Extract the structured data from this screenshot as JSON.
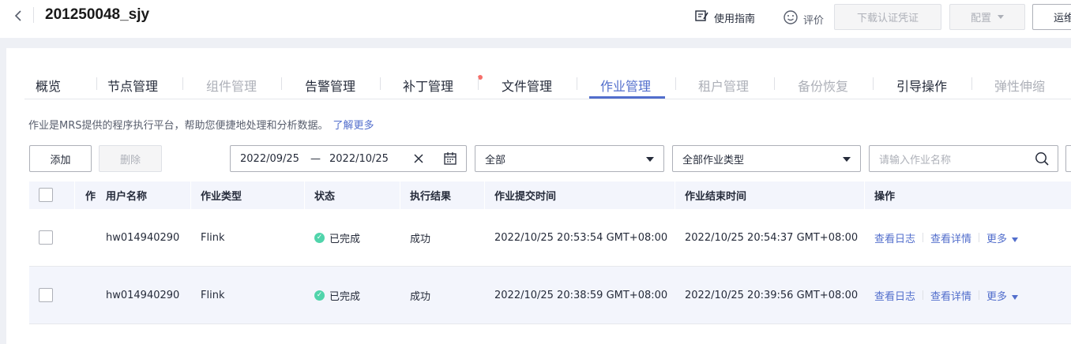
{
  "header": {
    "title": "201250048_sjy",
    "guide_label": "使用指南",
    "rate_label": "评价",
    "download_btn": "下载认证凭证",
    "config_btn": "配置",
    "ops_btn": "运维"
  },
  "tabs": [
    {
      "label": "概览",
      "state": "normal"
    },
    {
      "label": "节点管理",
      "state": "normal"
    },
    {
      "label": "组件管理",
      "state": "disabled"
    },
    {
      "label": "告警管理",
      "state": "normal"
    },
    {
      "label": "补丁管理",
      "state": "normal"
    },
    {
      "label": "文件管理",
      "state": "normal"
    },
    {
      "label": "作业管理",
      "state": "active"
    },
    {
      "label": "租户管理",
      "state": "disabled"
    },
    {
      "label": "备份恢复",
      "state": "disabled"
    },
    {
      "label": "引导操作",
      "state": "normal"
    },
    {
      "label": "弹性伸缩",
      "state": "disabled"
    }
  ],
  "description": {
    "text": "作业是MRS提供的程序执行平台，帮助您便捷地处理和分析数据。",
    "link": "了解更多"
  },
  "toolbar": {
    "add_label": "添加",
    "delete_label": "删除",
    "date_start": "2022/09/25",
    "date_sep": "—",
    "date_end": "2022/10/25",
    "status_select": "全部",
    "type_select": "全部作业类型",
    "search_placeholder": "请输入作业名称"
  },
  "table": {
    "columns": [
      "作",
      "用户名称",
      "作业类型",
      "状态",
      "执行结果",
      "作业提交时间",
      "作业结束时间",
      "操作"
    ],
    "rows": [
      {
        "user": "hw014940290",
        "type": "Flink",
        "status": "已完成",
        "result": "成功",
        "submit": "2022/10/25 20:53:54 GMT+08:00",
        "end": "2022/10/25 20:54:37 GMT+08:00",
        "log": "查看日志",
        "detail": "查看详情",
        "more": "更多"
      },
      {
        "user": "hw014940290",
        "type": "Flink",
        "status": "已完成",
        "result": "成功",
        "submit": "2022/10/25 20:38:59 GMT+08:00",
        "end": "2022/10/25 20:39:56 GMT+08:00",
        "log": "查看日志",
        "detail": "查看详情",
        "more": "更多"
      }
    ]
  },
  "colors": {
    "accent": "#526ecc",
    "success": "#50d4ab",
    "badge": "#f66f6a"
  }
}
